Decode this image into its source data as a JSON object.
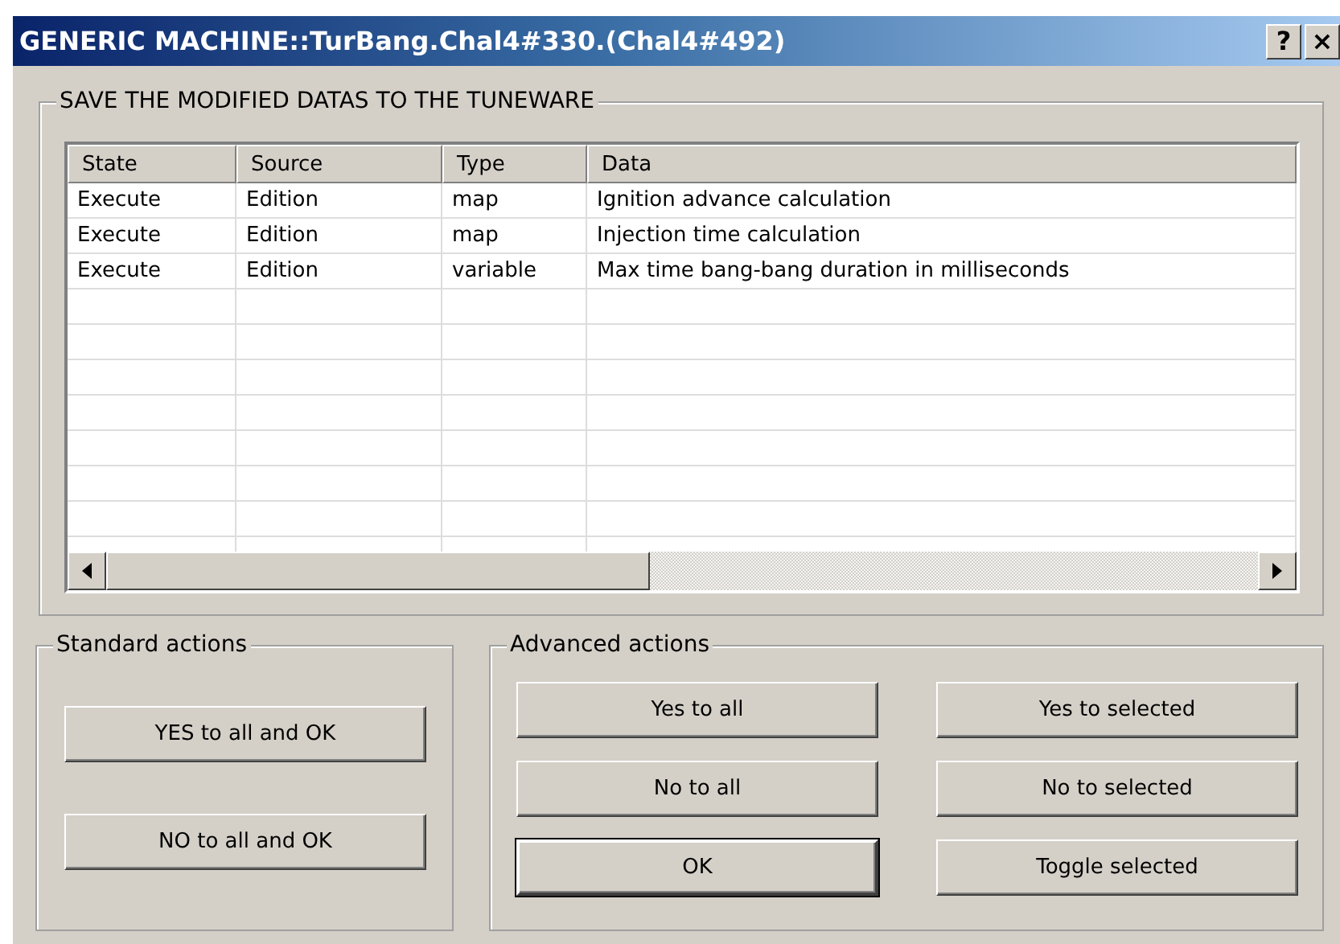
{
  "window": {
    "title": "GENERIC MACHINE::TurBang.Chal4#330.(Chal4#492)",
    "title_buttons": [
      "?",
      "×"
    ]
  },
  "save_group": {
    "title": "SAVE THE MODIFIED DATAS TO THE TUNEWARE",
    "table": {
      "columns": [
        "State",
        "Source",
        "Type",
        "Data"
      ],
      "rows": [
        [
          "Execute",
          "Edition",
          "map",
          "Ignition advance calculation"
        ],
        [
          "Execute",
          "Edition",
          "map",
          "Injection time calculation"
        ],
        [
          "Execute",
          "Edition",
          "variable",
          "Max time bang-bang duration in milliseconds"
        ]
      ]
    }
  },
  "standard_actions": {
    "title": "Standard actions",
    "buttons": [
      {
        "label": "YES to all and OK",
        "default": false
      },
      {
        "label": "NO to all and OK",
        "default": false
      }
    ]
  },
  "advanced_actions": {
    "title": "Advanced actions",
    "buttons": [
      {
        "label": "Yes to all",
        "default": false
      },
      {
        "label": "Yes to selected",
        "default": false
      },
      {
        "label": "No to all",
        "default": false
      },
      {
        "label": "No to selected",
        "default": false
      },
      {
        "label": "OK",
        "default": true
      },
      {
        "label": "Toggle selected",
        "default": false
      }
    ]
  }
}
